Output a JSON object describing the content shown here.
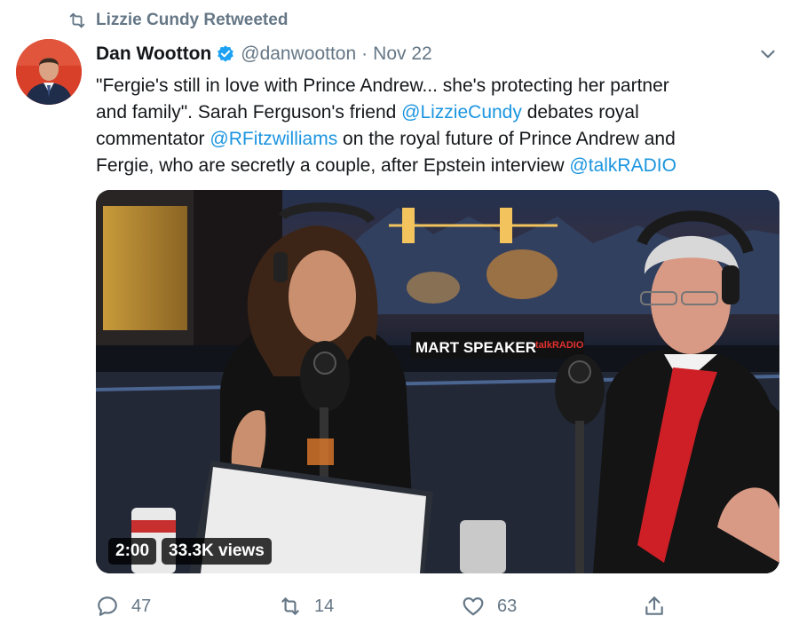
{
  "retweet": {
    "label": "Lizzie Cundy Retweeted"
  },
  "author": {
    "name": "Dan Wootton",
    "handle": "@danwootton",
    "separator": "·",
    "date": "Nov 22"
  },
  "tweet": {
    "lines": [
      [
        "\"Fergie's still in love with Prince Andrew... she's protecting her partner"
      ],
      [
        "and family\". Sarah Ferguson's friend ",
        "@LizzieCundy",
        " debates royal"
      ],
      [
        "commentator ",
        "@RFitzwilliams",
        " on the royal future of Prince Andrew and"
      ],
      [
        "Fergie, who are secretly a couple, after Epstein interview ",
        "@talkRADIO"
      ]
    ]
  },
  "video": {
    "duration": "2:00",
    "views": "33.3K views",
    "sign_text": "MART SPEAKER",
    "sign_brand": "talkRADIO"
  },
  "actions": {
    "replies": "47",
    "retweets": "14",
    "likes": "63"
  },
  "colors": {
    "link": "#1b95e0",
    "muted": "#657786",
    "verified": "#1da1f2"
  },
  "icons": [
    "retweet-icon",
    "verified-icon",
    "caret-down-icon",
    "reply-icon",
    "like-icon",
    "share-icon"
  ]
}
